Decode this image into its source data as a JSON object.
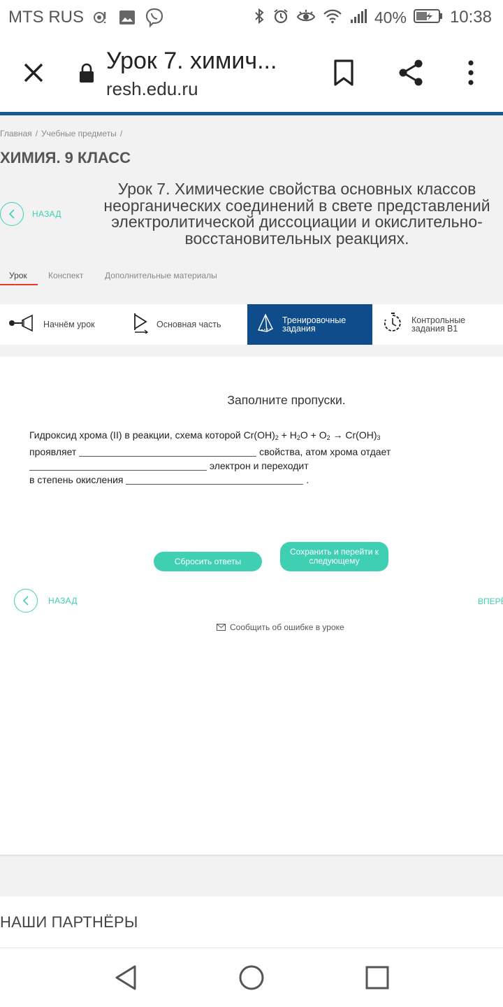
{
  "status_bar": {
    "carrier": "MTS RUS",
    "battery": "40%",
    "time": "10:38"
  },
  "toolbar": {
    "title": "Урок 7. химич...",
    "url": "resh.edu.ru"
  },
  "breadcrumb": [
    "Главная",
    "Учебные предметы"
  ],
  "breadcrumb_sep": "/",
  "subject": "ХИМИЯ. 9 КЛАСС",
  "back_label": "НАЗАД",
  "lesson_title": "Урок 7. Химические свойства основных классов неорганических соединений в свете представлений электролитической диссоциации и окислительно-восстановительных реакциях.",
  "tabs": [
    "Урок",
    "Конспект",
    "Дополнительные материалы"
  ],
  "steps": [
    {
      "label": "Начнём урок",
      "icon": "megaphone-icon"
    },
    {
      "label": "Основная часть",
      "icon": "play-icon"
    },
    {
      "label": "Тренировочные задания",
      "icon": "pyramid-icon"
    },
    {
      "label": "Контрольные задания В1",
      "icon": "stopwatch-icon"
    }
  ],
  "task": {
    "heading": "Заполните пропуски.",
    "line1": "Гидроксид хрома (II) в реакции, схема которой Cr(OH)",
    "sub1": "2",
    "plus1": " + H",
    "sub2": "2",
    "o_part": "O + O",
    "sub3": "2",
    "arrow": " → Cr(OH)",
    "sub4": "3",
    "line2_pre": "проявляет ",
    "line2_post": " свойства, атом хрома отдает",
    "line3_post": " электрон и переходит",
    "line4_pre": "в степень окисления ",
    "line4_post": " ."
  },
  "buttons": {
    "reset": "Сбросить ответы",
    "save": "Сохранить и перейти к следующему"
  },
  "nav": {
    "back": "НАЗАД",
    "next": "ВПЕРЁ"
  },
  "report": "Сообщить об ошибке в уроке",
  "partners": "НАШИ ПАРТНЁРЫ",
  "colors": {
    "accent": "#3fd0b4",
    "active_step": "#0e4c8c",
    "header_line": "#165a92",
    "tab_underline": "#e33a2d"
  }
}
